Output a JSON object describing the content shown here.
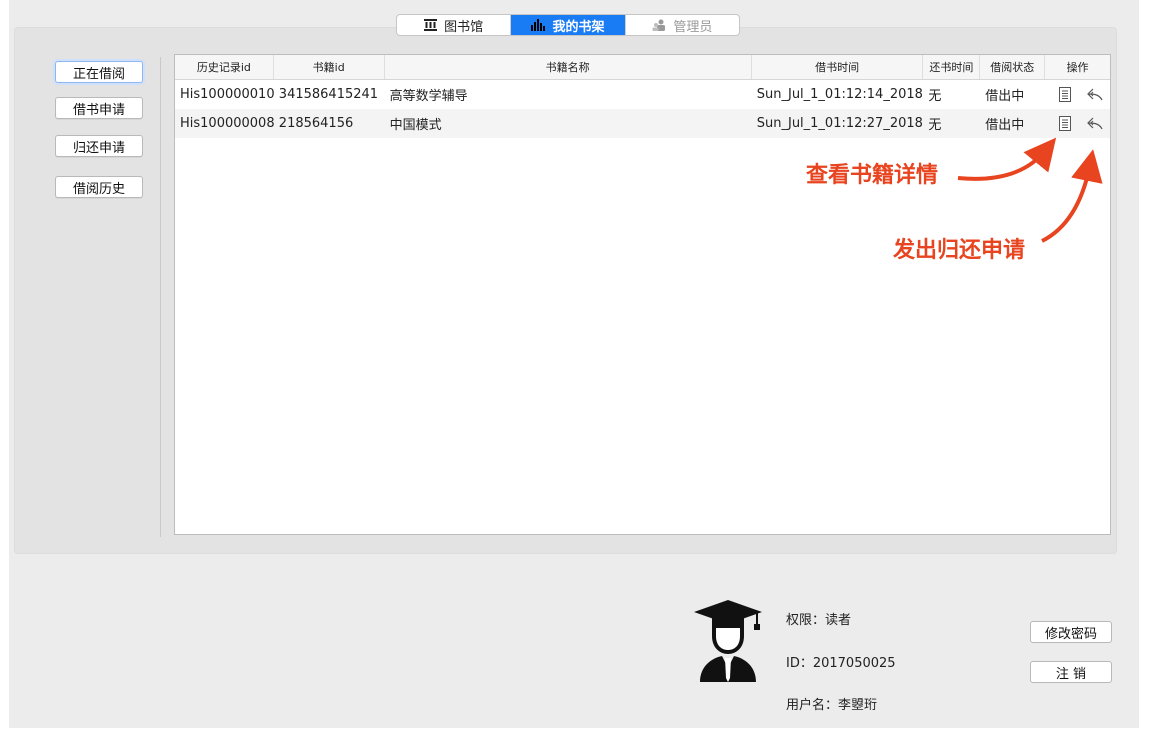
{
  "tabs": [
    {
      "label": "图书馆",
      "icon": "library-icon"
    },
    {
      "label": "我的书架",
      "icon": "bookshelf-chart-icon"
    },
    {
      "label": "管理员",
      "icon": "admin-icon"
    }
  ],
  "sidebar": {
    "items": [
      {
        "label": "正在借阅"
      },
      {
        "label": "借书申请"
      },
      {
        "label": "归还申请"
      },
      {
        "label": "借阅历史"
      }
    ]
  },
  "table": {
    "headers": [
      "历史记录id",
      "书籍id",
      "书籍名称",
      "借书时间",
      "还书时间",
      "借阅状态",
      "操作"
    ],
    "rows": [
      {
        "record_id": "His100000010",
        "book_id": "341586415241",
        "book_name": "高等数学辅导",
        "borrow_time": "Sun_Jul_1_01:12:14_2018",
        "return_time": "无",
        "status": "借出中"
      },
      {
        "record_id": "His100000008",
        "book_id": "218564156",
        "book_name": "中国模式",
        "borrow_time": "Sun_Jul_1_01:12:27_2018",
        "return_time": "无",
        "status": "借出中"
      }
    ]
  },
  "annotations": {
    "view_details": "查看书籍详情",
    "return_request": "发出归还申请",
    "color": "#e8441f"
  },
  "user": {
    "permission": "权限：读者",
    "id": "ID：2017050025",
    "username": "用户名：李曌珩"
  },
  "actions": {
    "change_password": "修改密码",
    "logout": "注 销"
  },
  "colors": {
    "accent": "#1a7cf5",
    "panel": "#e3e3e3",
    "window": "#ececec"
  }
}
